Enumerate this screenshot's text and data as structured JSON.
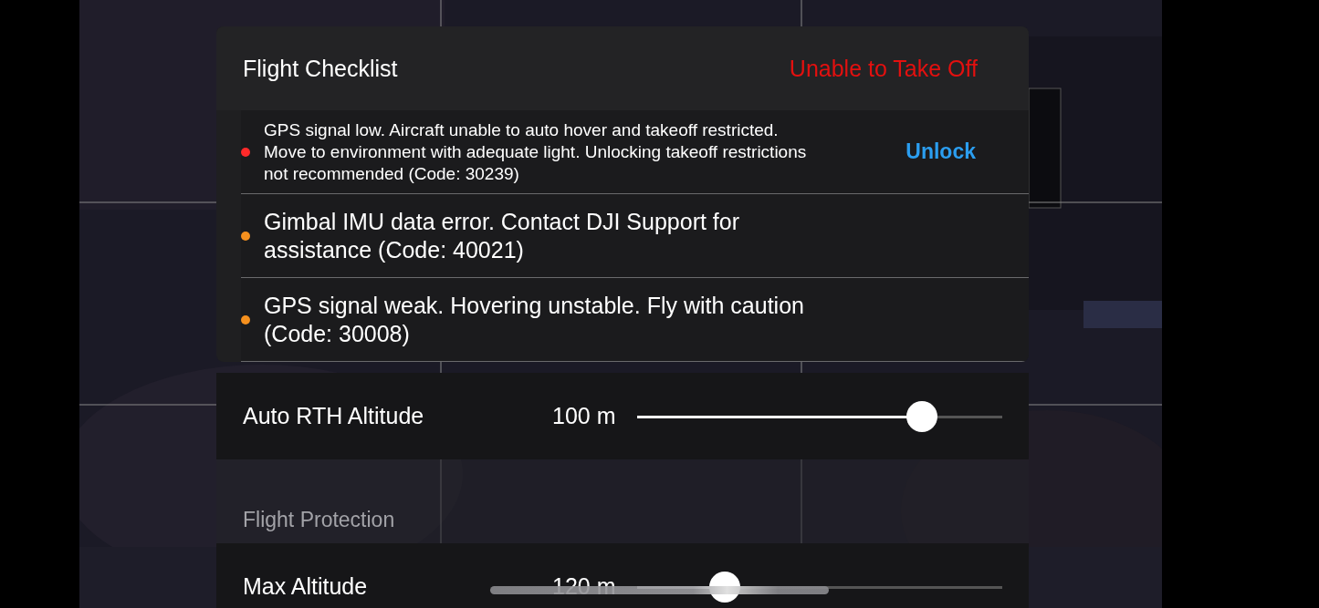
{
  "checklist": {
    "title": "Flight Checklist",
    "status": "Unable to Take Off",
    "items": [
      {
        "kind": "compact",
        "color": "#ff2a2a",
        "text": "GPS signal low. Aircraft unable to auto hover and takeoff restricted. Move to environment with adequate light. Unlocking takeoff restrictions not recommended (Code: 30239)",
        "action": "Unlock"
      },
      {
        "kind": "normal",
        "color": "#f5901e",
        "text": "Gimbal IMU data error. Contact DJI Support for assistance (Code: 40021)"
      },
      {
        "kind": "normal",
        "color": "#f5901e",
        "text": "GPS signal weak. Hovering unstable. Fly with caution (Code: 30008)"
      }
    ]
  },
  "settings": [
    {
      "kind": "slider",
      "label": "Auto RTH Altitude",
      "value": "100 m",
      "level": 0.78
    },
    {
      "kind": "spacer"
    },
    {
      "kind": "section",
      "label": "Flight Protection"
    },
    {
      "kind": "slider",
      "label": "Max Altitude",
      "value": "120 m",
      "level": 0.24
    }
  ]
}
